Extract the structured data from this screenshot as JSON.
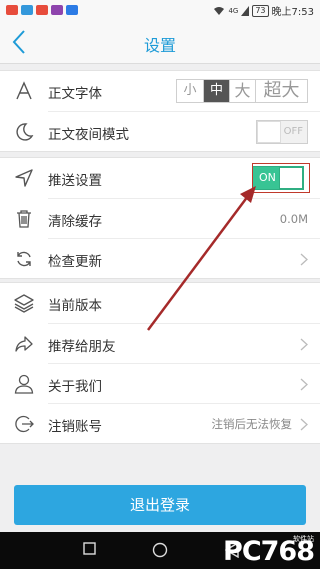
{
  "status_bar": {
    "battery": "73",
    "time": "晚上7:53",
    "network": "4G"
  },
  "header": {
    "title": "设置"
  },
  "group1": {
    "font": {
      "label": "正文字体",
      "options": [
        "小",
        "中",
        "大",
        "超大"
      ],
      "selected": "中"
    },
    "night_mode": {
      "label": "正文夜间模式",
      "toggle_text": "OFF"
    }
  },
  "group2": {
    "push": {
      "label": "推送设置",
      "toggle_text": "ON"
    },
    "cache": {
      "label": "清除缓存",
      "value": "0.0M"
    },
    "update": {
      "label": "检查更新"
    }
  },
  "group3": {
    "version": {
      "label": "当前版本"
    },
    "recommend": {
      "label": "推荐给朋友"
    },
    "about": {
      "label": "关于我们"
    },
    "deregister": {
      "label": "注销账号",
      "value": "注销后无法恢复"
    }
  },
  "logout": {
    "label": "退出登录"
  },
  "watermark": {
    "text": "PC768",
    "sub": "软件站"
  },
  "colors": {
    "accent": "#1e9bd7",
    "button": "#2da6e0",
    "toggle_on": "#38c494",
    "arrow": "#a52a2a"
  }
}
